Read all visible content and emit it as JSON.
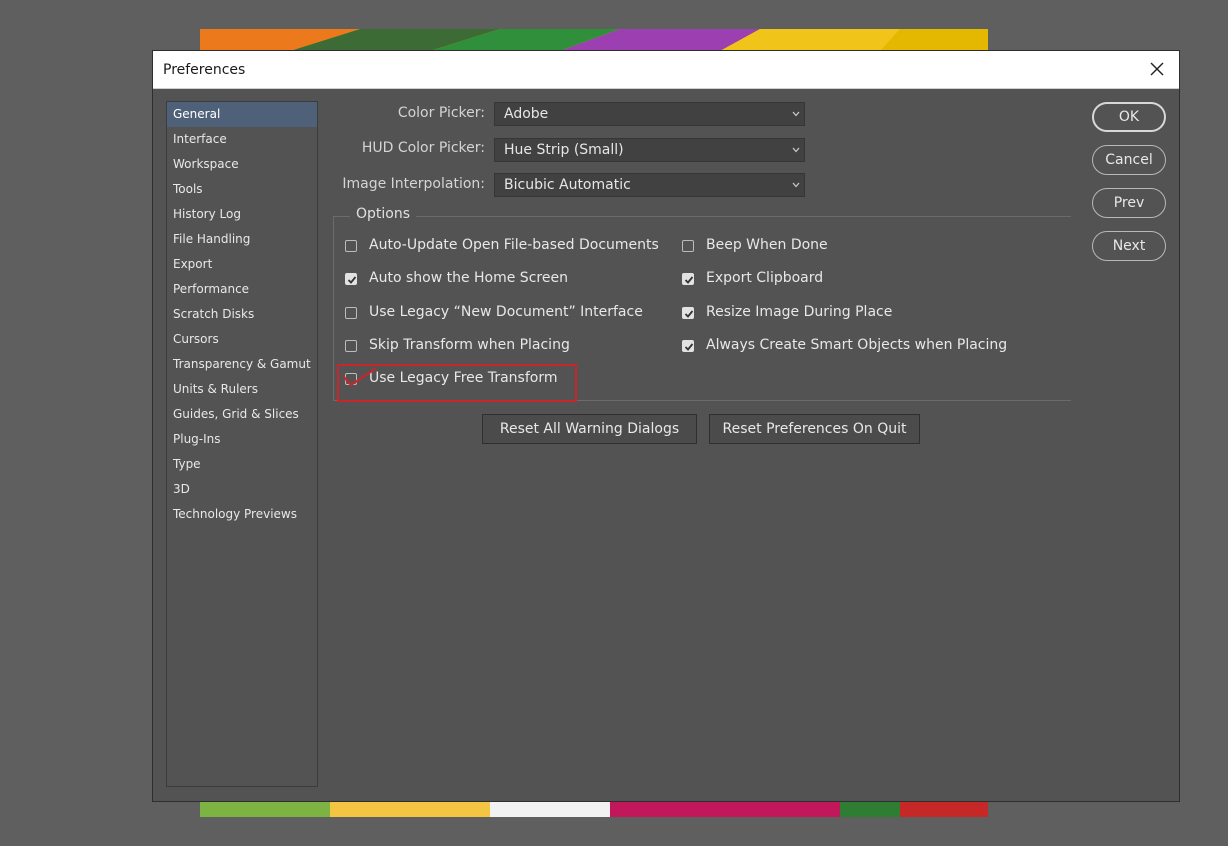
{
  "dialog": {
    "title": "Preferences",
    "close_icon": "close-icon"
  },
  "sidebar": {
    "items": [
      {
        "label": "General",
        "selected": true
      },
      {
        "label": "Interface"
      },
      {
        "label": "Workspace"
      },
      {
        "label": "Tools"
      },
      {
        "label": "History Log"
      },
      {
        "label": "File Handling"
      },
      {
        "label": "Export"
      },
      {
        "label": "Performance"
      },
      {
        "label": "Scratch Disks"
      },
      {
        "label": "Cursors"
      },
      {
        "label": "Transparency & Gamut"
      },
      {
        "label": "Units & Rulers"
      },
      {
        "label": "Guides, Grid & Slices"
      },
      {
        "label": "Plug-Ins"
      },
      {
        "label": "Type"
      },
      {
        "label": "3D"
      },
      {
        "label": "Technology Previews"
      }
    ]
  },
  "fields": {
    "color_picker": {
      "label": "Color Picker:",
      "value": "Adobe"
    },
    "hud_color_picker": {
      "label": "HUD Color Picker:",
      "value": "Hue Strip (Small)"
    },
    "image_interpolation": {
      "label": "Image Interpolation:",
      "value": "Bicubic Automatic"
    }
  },
  "options": {
    "legend": "Options",
    "left": [
      {
        "label": "Auto-Update Open File-based Documents",
        "checked": false
      },
      {
        "label": "Auto show the Home Screen",
        "checked": true
      },
      {
        "label": "Use Legacy “New Document” Interface",
        "checked": false
      },
      {
        "label": "Skip Transform when Placing",
        "checked": false
      },
      {
        "label": "Use Legacy Free Transform",
        "checked": false
      }
    ],
    "right": [
      {
        "label": "Beep When Done",
        "checked": false
      },
      {
        "label": "Export Clipboard",
        "checked": true
      },
      {
        "label": "Resize Image During Place",
        "checked": true
      },
      {
        "label": "Always Create Smart Objects when Placing",
        "checked": true
      }
    ]
  },
  "buttons": {
    "reset_warnings": "Reset All Warning Dialogs",
    "reset_on_quit": "Reset Preferences On Quit",
    "ok": "OK",
    "cancel": "Cancel",
    "prev": "Prev",
    "next": "Next"
  },
  "colors": {
    "dialog_bg": "#535353",
    "selected_item": "#4f6178",
    "annotation": "#c8262b"
  }
}
